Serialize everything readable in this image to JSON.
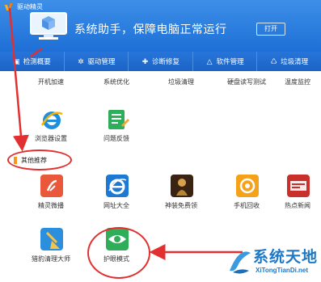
{
  "app": {
    "title": "驱动精灵",
    "slogan": "系统助手，保障电脑正常运行",
    "open_button": "打开"
  },
  "tabs": [
    {
      "label": "检测概要",
      "icon": "monitor-icon"
    },
    {
      "label": "驱动管理",
      "icon": "gear-icon"
    },
    {
      "label": "诊断修复",
      "icon": "wrench-icon"
    },
    {
      "label": "软件管理",
      "icon": "triangle-icon"
    },
    {
      "label": "垃圾清理",
      "icon": "trash-icon"
    }
  ],
  "tools_row1": [
    "开机加速",
    "系统优化",
    "垃圾清理",
    "硬盘读写测试",
    "温度监控"
  ],
  "tools_row2": [
    "浏览器设置",
    "问题反馈"
  ],
  "section_title": "其他推荐",
  "recommend_row1": [
    "精灵微播",
    "网址大全",
    "神装免费领",
    "手机回收",
    "热点新闻"
  ],
  "recommend_row2": [
    "猎豹清理大师",
    "护眼模式"
  ],
  "watermark": {
    "main": "系统天地",
    "sub": "XiTongTianDi.net"
  },
  "colors": {
    "header_blue": "#1e6fd6",
    "annotation_red": "#e23030",
    "section_marker": "#f39a1e"
  }
}
